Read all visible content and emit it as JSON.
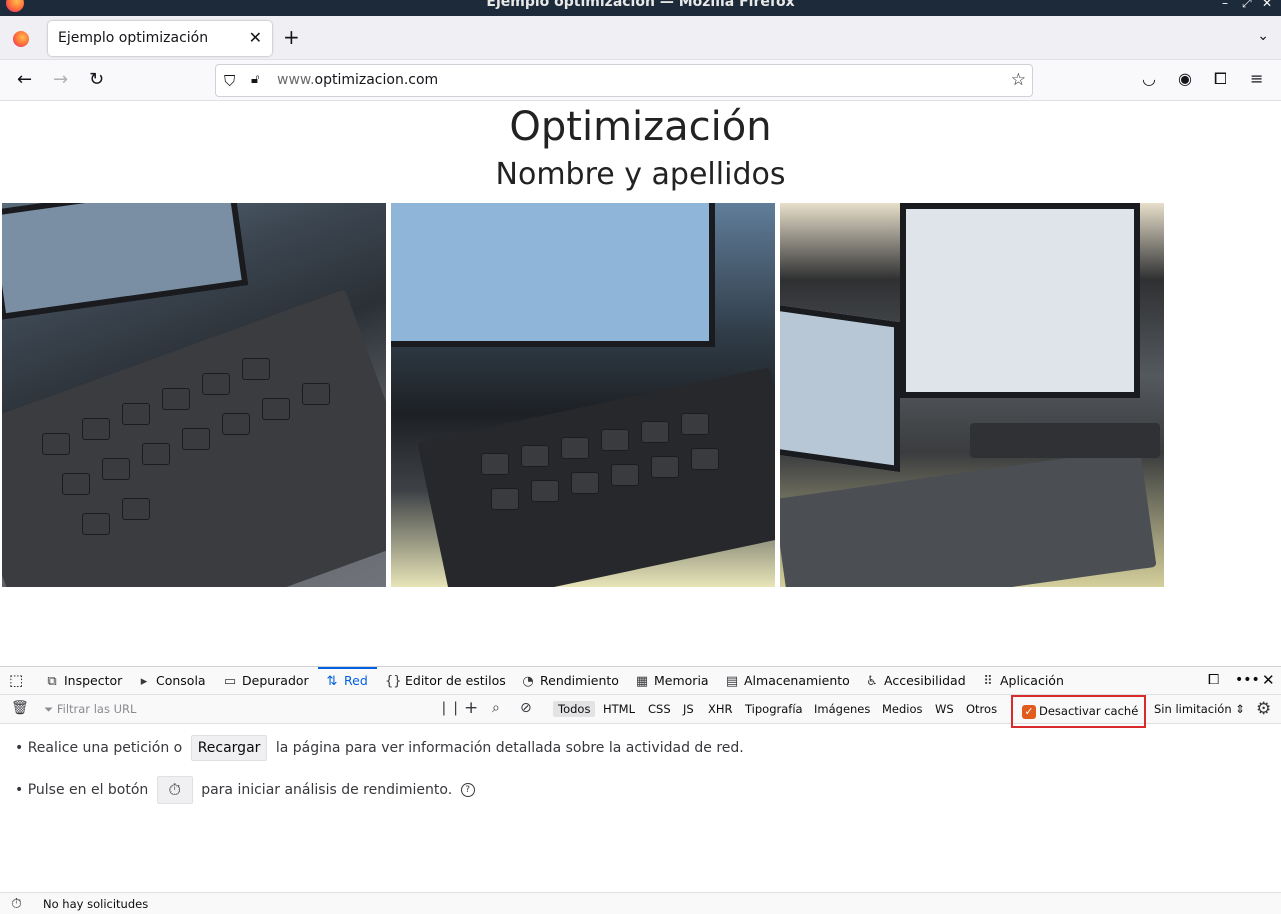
{
  "window": {
    "title": "Ejemplo optimización — Mozilla Firefox",
    "controls": [
      "–",
      "⤢",
      "✕"
    ]
  },
  "tabs": [
    {
      "label": "Ejemplo optimización",
      "active": true
    }
  ],
  "navbar": {
    "url_prefix": "www.",
    "url_domain": "optimizacion.com"
  },
  "page": {
    "heading": "Optimización",
    "subheading": "Nombre y apellidos",
    "images": [
      "laptop-keyboard-photo",
      "monitor-keyboard-photo",
      "laptop-and-monitor-photo"
    ]
  },
  "devtools": {
    "tabs": [
      {
        "label": "Inspector",
        "icon": "inspector-icon",
        "glyph": "⧉"
      },
      {
        "label": "Consola",
        "icon": "console-icon",
        "glyph": "▸"
      },
      {
        "label": "Depurador",
        "icon": "debugger-icon",
        "glyph": "▭"
      },
      {
        "label": "Red",
        "icon": "network-icon",
        "glyph": "⇅",
        "active": true
      },
      {
        "label": "Editor de estilos",
        "icon": "style-editor-icon",
        "glyph": "{}"
      },
      {
        "label": "Rendimiento",
        "icon": "performance-icon",
        "glyph": "◔"
      },
      {
        "label": "Memoria",
        "icon": "memory-icon",
        "glyph": "▦"
      },
      {
        "label": "Almacenamiento",
        "icon": "storage-icon",
        "glyph": "▤"
      },
      {
        "label": "Accesibilidad",
        "icon": "accessibility-icon",
        "glyph": "♿"
      },
      {
        "label": "Aplicación",
        "icon": "application-icon",
        "glyph": "⠿"
      }
    ],
    "filter_placeholder": "Filtrar las URL",
    "filter_types": [
      "Todos",
      "HTML",
      "CSS",
      "JS",
      "XHR",
      "Tipografía",
      "Imágenes",
      "Medios",
      "WS",
      "Otros"
    ],
    "active_filter": "Todos",
    "disable_cache_label": "Desactivar caché",
    "disable_cache_checked": true,
    "throttle_label": "Sin limitación",
    "empty_msg1_pre": "• Realice una petición o",
    "empty_msg1_btn": "Recargar",
    "empty_msg1_post": "la página para ver información detallada sobre la actividad de red.",
    "empty_msg2_pre": "• Pulse en el botón",
    "empty_msg2_post": "para iniciar análisis de rendimiento.",
    "status": "No hay solicitudes"
  },
  "colors": {
    "accent": "#0060df",
    "highlight_box": "#d92b2b",
    "checkbox": "#e25c1d"
  }
}
